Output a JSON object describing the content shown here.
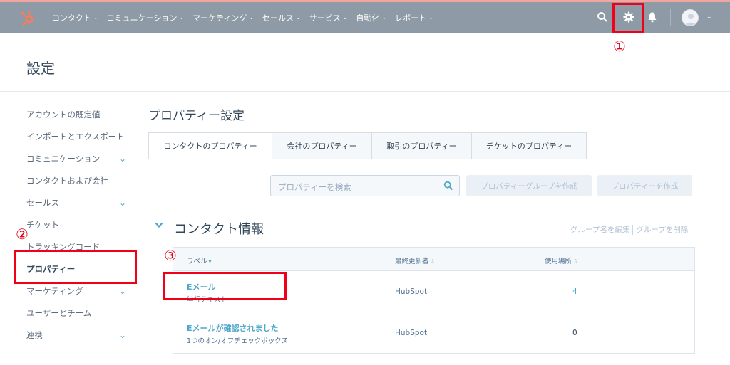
{
  "nav": {
    "menu": [
      "コンタクト",
      "コミュニケーション",
      "マーケティング",
      "セールス",
      "サービス",
      "自動化",
      "レポート"
    ],
    "icons": [
      "hubspot-logo",
      "search-icon",
      "gear-icon",
      "bell-icon",
      "avatar",
      "chevron-down-icon"
    ]
  },
  "page": {
    "title": "設定"
  },
  "sidebar": {
    "items": [
      {
        "label": "アカウントの既定値",
        "chevron": false
      },
      {
        "label": "インポートとエクスポート",
        "chevron": false
      },
      {
        "label": "コミュニケーション",
        "chevron": true
      },
      {
        "label": "コンタクトおよび会社",
        "chevron": false
      },
      {
        "label": "セールス",
        "chevron": true
      },
      {
        "label": "チケット",
        "chevron": false
      },
      {
        "label": "トラッキングコード",
        "chevron": false
      },
      {
        "label": "プロパティー",
        "chevron": false
      },
      {
        "label": "マーケティング",
        "chevron": true
      },
      {
        "label": "ユーザーとチーム",
        "chevron": false
      },
      {
        "label": "連携",
        "chevron": true
      }
    ],
    "active_index": 7
  },
  "main": {
    "title": "プロパティー設定",
    "tabs": [
      "コンタクトのプロパティー",
      "会社のプロパティー",
      "取引のプロパティー",
      "チケットのプロパティー"
    ],
    "search_placeholder": "プロパティーを検索",
    "create_group_button": "プロパティーグループを作成",
    "create_property_button": "プロパティーを作成",
    "group": {
      "title": "コンタクト情報",
      "edit_name": "グループ名を編集",
      "delete": "グループを削除"
    },
    "table": {
      "headers": [
        "ラベル",
        "最終更新者",
        "使用場所"
      ],
      "rows": [
        {
          "label": "Eメール",
          "type": "単行テキスト",
          "updated_by": "HubSpot",
          "usage": "4"
        },
        {
          "label": "Eメールが確認されました",
          "type": "1つのオン/オフチェックボックス",
          "updated_by": "HubSpot",
          "usage": "0"
        }
      ]
    }
  },
  "annotations": {
    "markers": [
      "①",
      "②",
      "③"
    ],
    "color": "#f00019"
  },
  "colors": {
    "nav_bg": "#8e9aa6",
    "link": "#4fa8c9",
    "text": "#33475b"
  }
}
